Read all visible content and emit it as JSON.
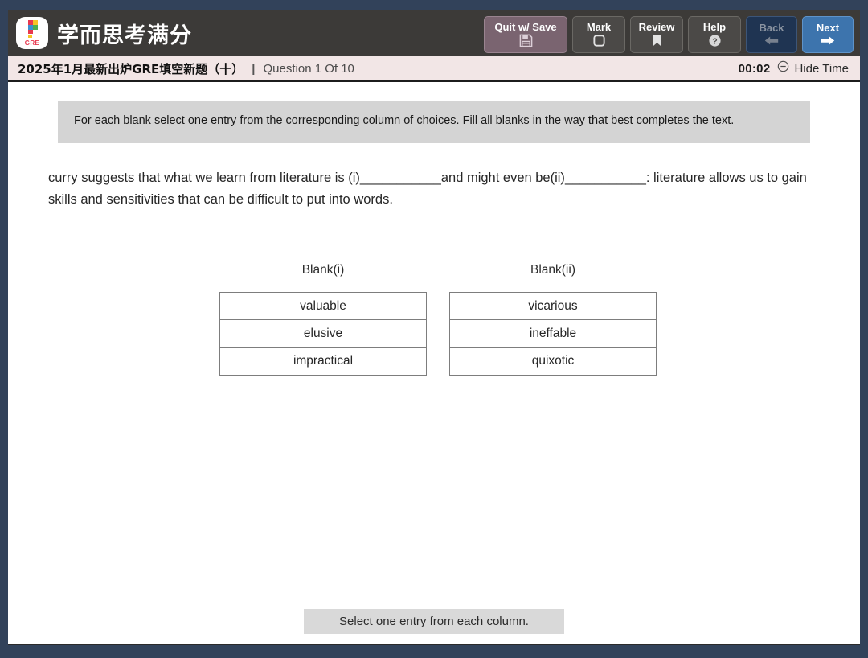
{
  "header": {
    "brand_title": "学而思考满分",
    "logo_badge": "GRE",
    "logo_icon": "question-mark-blocks-icon",
    "buttons": [
      {
        "id": "quit-with-save",
        "label": "Quit w/ Save",
        "icon": "save-floppy-icon"
      },
      {
        "id": "mark",
        "label": "Mark",
        "icon": "square-outline-icon"
      },
      {
        "id": "review",
        "label": "Review",
        "icon": "bookmark-icon"
      },
      {
        "id": "help",
        "label": "Help",
        "icon": "question-circle-icon"
      },
      {
        "id": "back",
        "label": "Back",
        "icon": "arrow-left-icon"
      },
      {
        "id": "next",
        "label": "Next",
        "icon": "arrow-right-icon"
      }
    ]
  },
  "subheader": {
    "title": "2025年1月最新出炉GRE填空新题（十）",
    "separator": "|",
    "question_counter": "Question 1 Of 10",
    "timer": "00:02",
    "hide_time_label": "Hide Time",
    "hide_time_icon": "circle-minus-icon"
  },
  "main": {
    "instructions": "For each blank select one entry from the corresponding column of choices. Fill all blanks in the way that best completes the text.",
    "passage": {
      "part1": "curry suggests that what we learn from literature is (i)",
      "blank1": "___________",
      "part2": "and might even be(ii)",
      "blank2": "___________",
      "part3": ": literature allows us to gain skills and sensitivities that can be difficult to put into words."
    },
    "columns": [
      {
        "heading": "Blank(i)",
        "choices": [
          "valuable",
          "elusive",
          "impractical"
        ]
      },
      {
        "heading": "Blank(ii)",
        "choices": [
          "vicarious",
          "ineffable",
          "quixotic"
        ]
      }
    ],
    "footer_note": "Select one entry from each column."
  },
  "colors": {
    "frame": "#32425a",
    "header_bar": "#3c3a38",
    "subheader_bar": "#f2e6e6",
    "quit_button": "#7a6470",
    "next_button": "#3d74ad",
    "back_button": "#1f3452",
    "instruction_bg": "#d4d4d4",
    "footer_bg": "#d9d9d9"
  }
}
